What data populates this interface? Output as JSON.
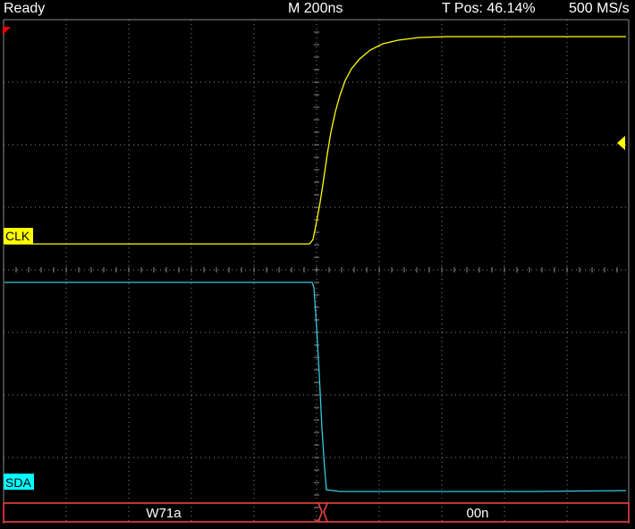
{
  "status": {
    "state": "Ready",
    "timebase": "M 200ns",
    "trigger_position": "T Pos: 46.14%",
    "sample_rate": "500 MS/s"
  },
  "channels": [
    {
      "label": "CLK",
      "color": "#ffff00"
    },
    {
      "label": "SDA",
      "color": "#00ffff"
    }
  ],
  "bus_decode": {
    "color": "#ff4444",
    "segments": [
      {
        "text": "W71a"
      },
      {
        "text": "00n"
      }
    ]
  },
  "colors": {
    "background": "#000000",
    "grid": "#8c8c8c",
    "trigger_marker": "#ffff00",
    "trigger_time_marker": "#ff0000"
  }
}
